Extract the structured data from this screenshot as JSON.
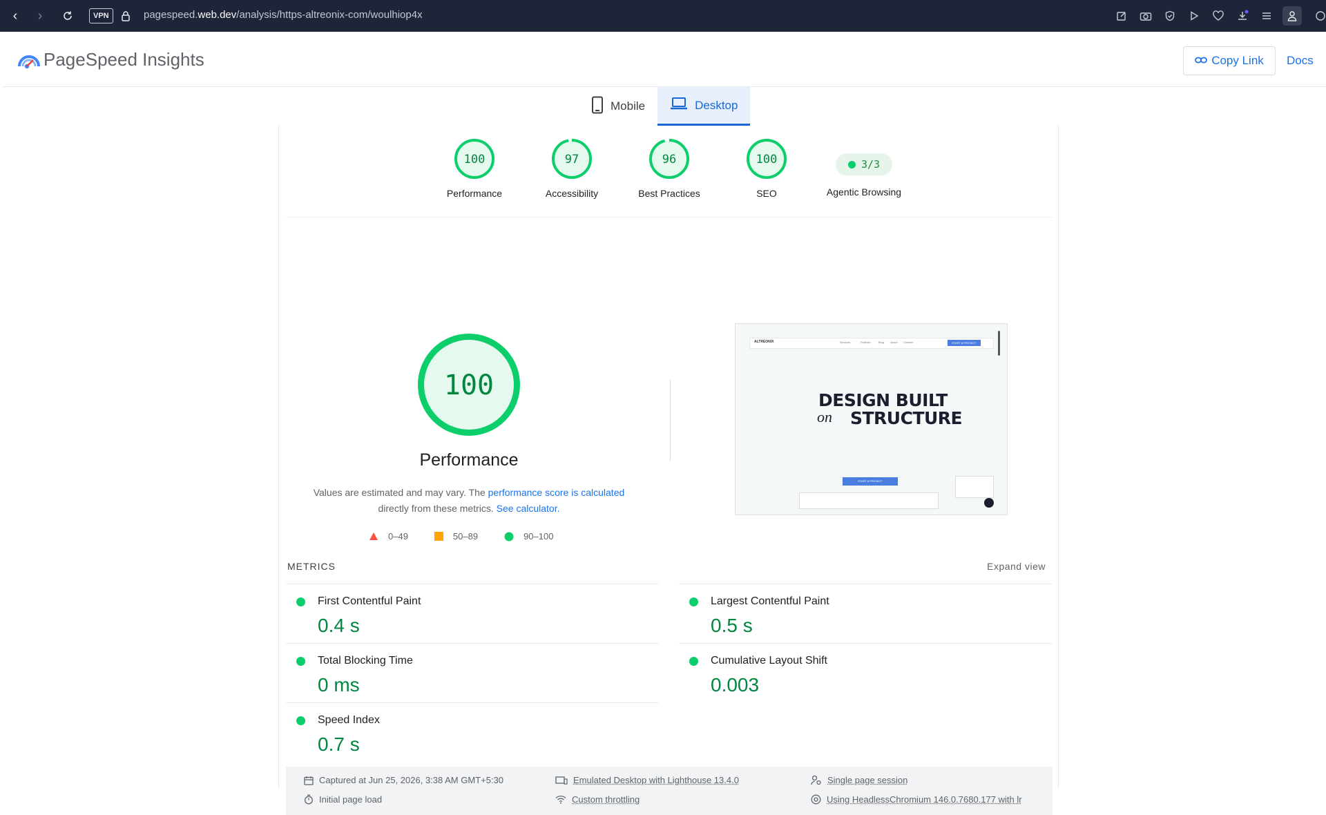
{
  "browser": {
    "vpn_label": "VPN",
    "url_pre": "pagespeed.",
    "url_domain": "web.dev",
    "url_path": "/analysis/https-altreonix-com/woulhiop4x"
  },
  "header": {
    "brand": "PageSpeed Insights",
    "copy_link": "Copy Link",
    "docs": "Docs"
  },
  "tabs": [
    {
      "label": "Mobile",
      "icon": "phone-icon",
      "active": false
    },
    {
      "label": "Desktop",
      "icon": "laptop-icon",
      "active": true
    }
  ],
  "gauges": [
    {
      "score": "100",
      "value": 100,
      "label": "Performance"
    },
    {
      "score": "97",
      "value": 97,
      "label": "Accessibility"
    },
    {
      "score": "96",
      "value": 96,
      "label": "Best Practices"
    },
    {
      "score": "100",
      "value": 100,
      "label": "SEO"
    }
  ],
  "agentic": {
    "value": "3/3",
    "label": "Agentic Browsing"
  },
  "performance": {
    "score": "100",
    "title": "Performance",
    "desc_part1": "Values are estimated and may vary. The ",
    "desc_link1": "performance score is calculated",
    "desc_part2": " directly from these metrics. ",
    "desc_link2": "See calculator."
  },
  "legend": [
    {
      "range": "0–49",
      "color": "#ff4e42",
      "shape": "triangle"
    },
    {
      "range": "50–89",
      "color": "#ffa400",
      "shape": "square"
    },
    {
      "range": "90–100",
      "color": "#0cce6b",
      "shape": "circle"
    }
  ],
  "screenshot": {
    "brand": "ALTREONIX",
    "nav": [
      "Services",
      "Portfolio",
      "Blog",
      "About",
      "Contact"
    ],
    "cta": "START A PROJECT",
    "headline_1": "DESIGN  BUILT",
    "headline_on": "on",
    "headline_2": "STRUCTURE",
    "button": "START A PROJECT"
  },
  "metrics_heading": "METRICS",
  "expand_view": "Expand view",
  "metrics": [
    {
      "label": "First Contentful Paint",
      "value": "0.4 s"
    },
    {
      "label": "Largest Contentful Paint",
      "value": "0.5 s"
    },
    {
      "label": "Total Blocking Time",
      "value": "0 ms"
    },
    {
      "label": "Cumulative Layout Shift",
      "value": "0.003"
    },
    {
      "label": "Speed Index",
      "value": "0.7 s"
    }
  ],
  "footer": {
    "captured": "Captured at Jun 25, 2026, 3:38 AM GMT+5:30",
    "initial": "Initial page load",
    "emulated": "Emulated Desktop with Lighthouse 13.4.0",
    "throttling": "Custom throttling",
    "session": "Single page session",
    "browser": "Using HeadlessChromium 146.0.7680.177 with lr"
  },
  "colors": {
    "pass": "#0cce6b",
    "pass_text": "#018642",
    "accent": "#1a73e8"
  }
}
